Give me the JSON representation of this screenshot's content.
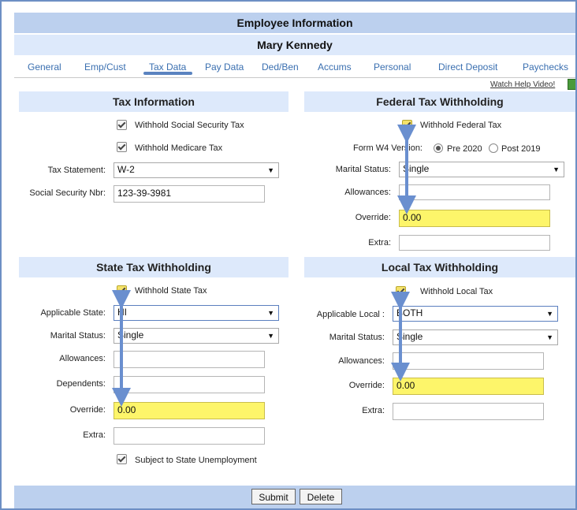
{
  "header": {
    "title": "Employee Information",
    "employee_name": "Mary Kennedy"
  },
  "tabs": [
    "General",
    "Emp/Cust",
    "Tax Data",
    "Pay Data",
    "Ded/Ben",
    "Accums",
    "Personal",
    "Direct Deposit",
    "Paychecks"
  ],
  "active_tab": "Tax Data",
  "help_link": "Watch Help Video!",
  "tax_info": {
    "title": "Tax Information",
    "withhold_ss": "Withhold Social Security Tax",
    "withhold_medicare": "Withhold Medicare Tax",
    "tax_statement_label": "Tax Statement:",
    "tax_statement_value": "W-2",
    "ssn_label": "Social Security Nbr:",
    "ssn_value": "123-39-3981"
  },
  "federal": {
    "title": "Federal Tax Withholding",
    "withhold_label": "Withhold Federal Tax",
    "form_w4_label": "Form W4 Version:",
    "pre_2020": "Pre 2020",
    "post_2019": "Post 2019",
    "marital_label": "Marital Status:",
    "marital_value": "Single",
    "allowances_label": "Allowances:",
    "allowances_value": "",
    "override_label": "Override:",
    "override_value": "0.00",
    "extra_label": "Extra:",
    "extra_value": ""
  },
  "state": {
    "title": "State Tax Withholding",
    "withhold_label": "Withhold State Tax",
    "applicable_label": "Applicable State:",
    "applicable_value": "HI",
    "marital_label": "Marital Status:",
    "marital_value": "Single",
    "allowances_label": "Allowances:",
    "allowances_value": "",
    "dependents_label": "Dependents:",
    "dependents_value": "",
    "override_label": "Override:",
    "override_value": "0.00",
    "extra_label": "Extra:",
    "extra_value": "",
    "sui_label": "Subject to State Unemployment"
  },
  "local": {
    "title": "Local Tax Withholding",
    "withhold_label": "Withhold Local Tax",
    "applicable_label": "Applicable Local :",
    "applicable_value": "BOTH",
    "marital_label": "Marital Status:",
    "marital_value": "Single",
    "allowances_label": "Allowances:",
    "allowances_value": "",
    "override_label": "Override:",
    "override_value": "0.00",
    "extra_label": "Extra:",
    "extra_value": ""
  },
  "buttons": {
    "submit": "Submit",
    "delete": "Delete"
  },
  "colors": {
    "header_bg": "#bcd0ee",
    "subheader_bg": "#dde9fb",
    "highlight": "#fdf56a",
    "arrow": "#6a8fcf"
  },
  "icons": {
    "help": "film-icon",
    "dropdown": "chevron-down-icon"
  }
}
